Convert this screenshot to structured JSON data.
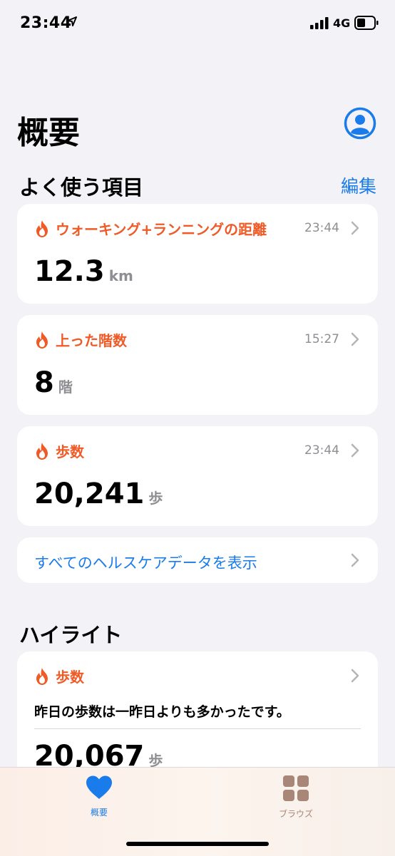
{
  "status_bar": {
    "time": "23:44",
    "network": "4G"
  },
  "header": {
    "title": "概要"
  },
  "favorites": {
    "title": "よく使う項目",
    "edit_label": "編集",
    "cards": [
      {
        "label": "ウォーキング+ランニングの距離",
        "time": "23:44",
        "value": "12.3",
        "unit": "km"
      },
      {
        "label": "上った階数",
        "time": "15:27",
        "value": "8",
        "unit": "階"
      },
      {
        "label": "歩数",
        "time": "23:44",
        "value": "20,241",
        "unit": "歩"
      }
    ],
    "show_all_label": "すべてのヘルスケアデータを表示"
  },
  "highlights": {
    "title": "ハイライト",
    "card": {
      "label": "歩数",
      "text": "昨日の歩数は一昨日よりも多かったです。",
      "value": "20,067",
      "unit": "歩"
    }
  },
  "tab_bar": {
    "tabs": [
      {
        "label": "概要",
        "icon": "heart-icon",
        "active": true
      },
      {
        "label": "ブラウズ",
        "icon": "grid-icon",
        "active": false
      }
    ]
  },
  "colors": {
    "accent": "#1a7bea",
    "activity": "#f05a26",
    "secondary": "#8e8e93",
    "background": "#f2f2f7",
    "inactive_tab": "#a88678"
  }
}
